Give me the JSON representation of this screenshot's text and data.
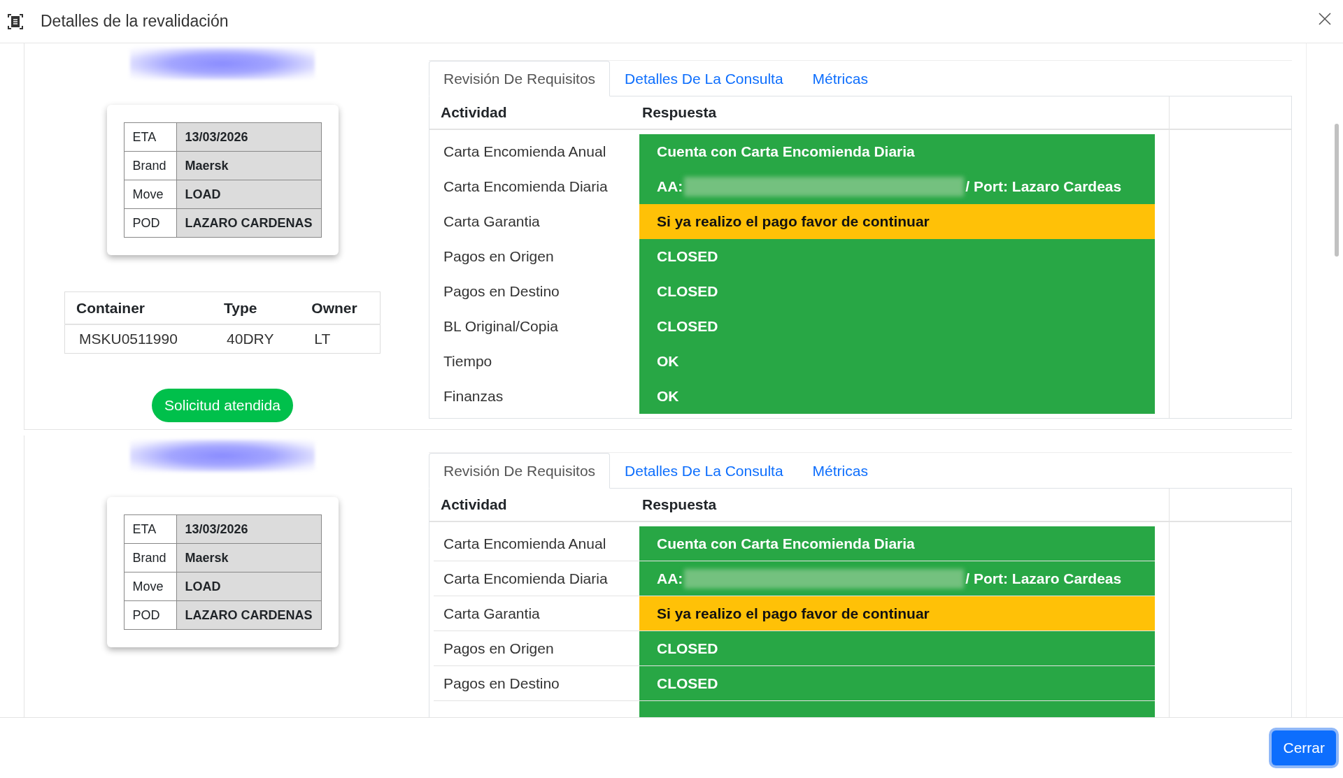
{
  "window": {
    "title": "Detalles de la revalidación"
  },
  "requests": [
    {
      "summary": [
        {
          "label": "ETA",
          "value": "13/03/2026"
        },
        {
          "label": "Brand",
          "value": "Maersk"
        },
        {
          "label": "Move",
          "value": "LOAD"
        },
        {
          "label": "POD",
          "value": "LAZARO CARDENAS"
        }
      ],
      "containers": {
        "columns": [
          "Container",
          "Type",
          "Owner"
        ],
        "rows": [
          [
            "MSKU0511990",
            "40DRY",
            "LT"
          ]
        ]
      },
      "status_button": "Solicitud atendida",
      "tabs": [
        {
          "label": "Revisión De Requisitos",
          "selected": true
        },
        {
          "label": "Detalles De La Consulta",
          "selected": false
        },
        {
          "label": "Métricas",
          "selected": false
        }
      ],
      "checks": {
        "columns": [
          "Actividad",
          "Respuesta"
        ],
        "row_lines": false,
        "rows": [
          {
            "activity": "Carta Encomienda Anual",
            "kind": "text",
            "response": "Cuenta con Carta Encomienda Diaria",
            "color": "#28a745"
          },
          {
            "activity": "Carta Encomienda Diaria",
            "kind": "redacted",
            "prefix": "AA:",
            "suffix": "/ Port: Lazaro Cardeas",
            "color": "#28a745"
          },
          {
            "activity": "Carta Garantia",
            "kind": "text",
            "response": "Si ya realizo el pago favor de continuar",
            "color": "#ffc107"
          },
          {
            "activity": "Pagos en Origen",
            "kind": "text",
            "response": "CLOSED",
            "color": "#28a745"
          },
          {
            "activity": "Pagos en Destino",
            "kind": "text",
            "response": "CLOSED",
            "color": "#28a745"
          },
          {
            "activity": "BL Original/Copia",
            "kind": "text",
            "response": "CLOSED",
            "color": "#28a745"
          },
          {
            "activity": "Tiempo",
            "kind": "text",
            "response": "OK",
            "color": "#28a745"
          },
          {
            "activity": "Finanzas",
            "kind": "text",
            "response": "OK",
            "color": "#28a745"
          }
        ]
      }
    },
    {
      "summary": [
        {
          "label": "ETA",
          "value": "13/03/2026"
        },
        {
          "label": "Brand",
          "value": "Maersk"
        },
        {
          "label": "Move",
          "value": "LOAD"
        },
        {
          "label": "POD",
          "value": "LAZARO CARDENAS"
        }
      ],
      "tabs": [
        {
          "label": "Revisión De Requisitos",
          "selected": true
        },
        {
          "label": "Detalles De La Consulta",
          "selected": false
        },
        {
          "label": "Métricas",
          "selected": false
        }
      ],
      "checks": {
        "columns": [
          "Actividad",
          "Respuesta"
        ],
        "row_lines": true,
        "rows": [
          {
            "activity": "Carta Encomienda Anual",
            "kind": "text",
            "response": "Cuenta con Carta Encomienda Diaria",
            "color": "#28a745"
          },
          {
            "activity": "Carta Encomienda Diaria",
            "kind": "redacted",
            "prefix": "AA:",
            "suffix": "/ Port: Lazaro Cardeas",
            "color": "#28a745"
          },
          {
            "activity": "Carta Garantia",
            "kind": "text",
            "response": "Si ya realizo el pago favor de continuar",
            "color": "#ffc107"
          },
          {
            "activity": "Pagos en Origen",
            "kind": "text",
            "response": "CLOSED",
            "color": "#28a745"
          },
          {
            "activity": "Pagos en Destino",
            "kind": "text",
            "response": "CLOSED",
            "color": "#28a745"
          }
        ]
      }
    }
  ],
  "footer": {
    "close_button": "Cerrar"
  }
}
